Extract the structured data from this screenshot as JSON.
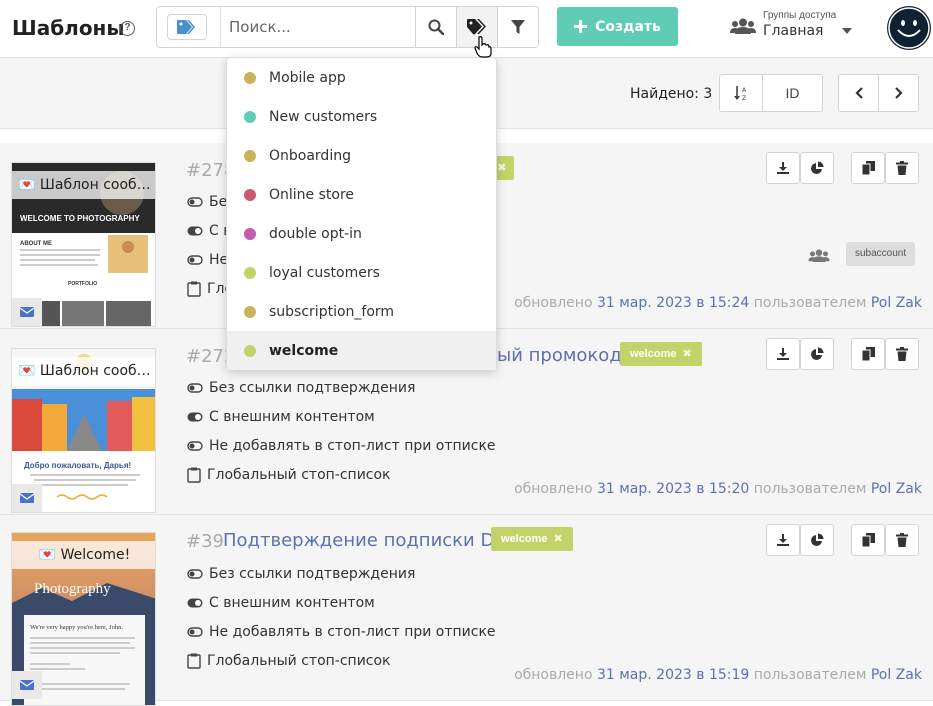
{
  "header": {
    "title": "Шаблоны",
    "help": "?",
    "search_placeholder": "Поиск...",
    "create_label": "Создать",
    "group_label": "Группы доступа",
    "group_value": "Главная"
  },
  "toolbar": {
    "found": "Найдено: 3",
    "sort_id": "ID"
  },
  "dropdown": {
    "items": [
      {
        "label": "Mobile app",
        "color": "#c9b35a"
      },
      {
        "label": "New customers",
        "color": "#5fcdb4"
      },
      {
        "label": "Onboarding",
        "color": "#c9b35a"
      },
      {
        "label": "Online store",
        "color": "#c9596b"
      },
      {
        "label": "double opt-in",
        "color": "#c95aaa"
      },
      {
        "label": "loyal customers",
        "color": "#c3d36a"
      },
      {
        "label": "subscription_form",
        "color": "#c9b35a"
      },
      {
        "label": "welcome",
        "color": "#c3d36a"
      }
    ]
  },
  "templates": [
    {
      "thumb_title": "Шаблон сооб…",
      "id": "#278",
      "name": "",
      "tag": "e",
      "features": [
        "Бе",
        "С в",
        "Не",
        "Глоб"
      ],
      "subaccount": "subaccount",
      "updated_prefix": "обновлено",
      "date": "31 мар. 2023 в 15:24",
      "user_prefix": "пользователем",
      "user": "Pol Zak"
    },
    {
      "thumb_title": "Шаблон сооб…",
      "id": "#272",
      "name": "ый промокод",
      "tag": "welcome",
      "features": [
        "Без ссылки подтверждения",
        "С внешним контентом",
        "Не добавлять в стоп-лист при отписке",
        "Глобальный стоп-список"
      ],
      "updated_prefix": "обновлено",
      "date": "31 мар. 2023 в 15:20",
      "user_prefix": "пользователем",
      "user": "Pol Zak"
    },
    {
      "thumb_title": "Welcome!",
      "id": "#39",
      "name": "Подтверждение подписки DOI",
      "tag": "welcome",
      "features": [
        "Без ссылки подтверждения",
        "С внешним контентом",
        "Не добавлять в стоп-лист при отписке",
        "Глобальный стоп-список"
      ],
      "updated_prefix": "обновлено",
      "date": "31 мар. 2023 в 15:19",
      "user_prefix": "пользователем",
      "user": "Pol Zak"
    }
  ],
  "thumb_texts": {
    "t1_heading": "WELCOME TO PHOTOGRAPHY",
    "t1_about": "ABOUT ME",
    "t1_portfolio": "PORTFOLIO",
    "t2_greeting": "Добро пожаловать, Дарья!",
    "t3_photo": "Photography",
    "t3_happy": "We're very happy you're here, John."
  },
  "icons": {
    "tag": "tag-icon",
    "search": "search-icon",
    "filter": "filter-icon",
    "plus": "plus-icon",
    "users": "users-icon",
    "download": "download-icon",
    "stats": "pie-chart-icon",
    "copy": "copy-icon",
    "delete": "trash-icon",
    "mail": "mail-icon"
  },
  "colors": {
    "accent": "#5fcdb4",
    "link": "#5b72b0",
    "tag": "#c3d36a"
  }
}
